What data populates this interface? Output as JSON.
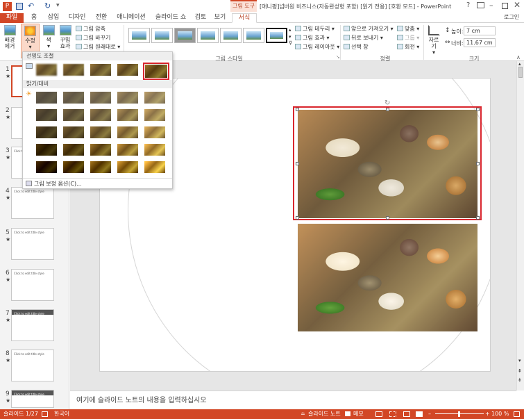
{
  "window": {
    "title": "[애니펑]넘버원 비즈니스(자동완성형 포함) [읽기 전용] [호환 모드] - PowerPoint",
    "context_tab": "그림 도구",
    "help": "?",
    "login": "로그인"
  },
  "tabs": [
    "파일",
    "홈",
    "삽입",
    "디자인",
    "전환",
    "애니메이션",
    "슬라이드 쇼",
    "검토",
    "보기",
    "서식"
  ],
  "ribbon": {
    "remove_bg": "배경\n제거",
    "corrections": "수정",
    "color": "색",
    "artistic": "꾸밈\n효과",
    "compress": "그림 압축",
    "change": "그림 바꾸기",
    "reset": "그림 원래대로",
    "picture_styles_group": "그림 스타일",
    "border": "그림 테두리",
    "effects": "그림 효과",
    "layout": "그림 레이아웃",
    "bring_forward": "앞으로 가져오기",
    "send_backward": "뒤로 보내기",
    "selection_pane": "선택 창",
    "align": "맞춤",
    "group": "그룹",
    "rotate": "회전",
    "arrange_group": "정렬",
    "crop": "자르기",
    "height_label": "높이:",
    "height_value": "7 cm",
    "width_label": "너비:",
    "width_value": "11.67 cm",
    "size_group": "크기"
  },
  "gallery": {
    "sharpen_header": "선명도 조절",
    "brightness_header": "밝기/대비",
    "options": "그림 보정 옵션(C)..."
  },
  "slides": [
    {
      "num": "1",
      "title": ""
    },
    {
      "num": "2",
      "title": ""
    },
    {
      "num": "3",
      "title": "Click to edit title style"
    },
    {
      "num": "4",
      "title": "Click to edit title style"
    },
    {
      "num": "5",
      "title": "Click to edit title style"
    },
    {
      "num": "6",
      "title": "Click to edit title style"
    },
    {
      "num": "7",
      "title": "Click to edit title style"
    },
    {
      "num": "8",
      "title": "Click to edit title style"
    },
    {
      "num": "9",
      "title": "Click to edit title style"
    }
  ],
  "notes_placeholder": "여기에 슬라이드 노트의 내용을 입력하십시오",
  "status": {
    "slide": "슬라이드 1/27",
    "language": "한국어",
    "notes": "슬라이드 노트",
    "comments": "메모",
    "zoom": "100 %"
  }
}
